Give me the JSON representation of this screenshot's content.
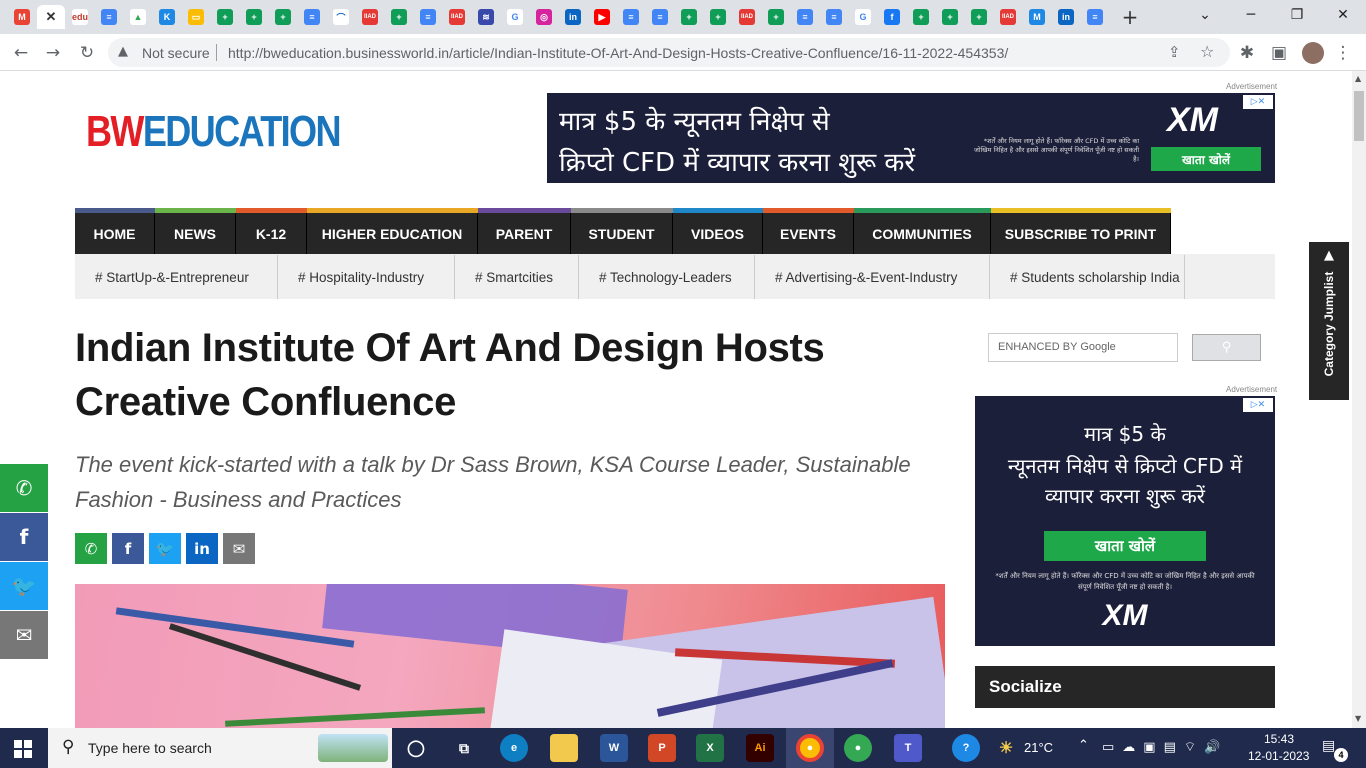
{
  "browser": {
    "tabs": [
      {
        "icon": "gmail-icon",
        "label": "M",
        "color": "#ea4335",
        "text": "#fff"
      },
      {
        "icon": "close-tab-icon",
        "label": "✕",
        "color": "#fff",
        "text": "#333",
        "active": true
      },
      {
        "icon": "edu-icon",
        "label": "edu",
        "color": "#fff",
        "text": "#c0392b"
      },
      {
        "icon": "docs-icon",
        "label": "≡",
        "color": "#4285f4",
        "text": "#fff"
      },
      {
        "icon": "drive-icon",
        "label": "▲",
        "color": "#fff",
        "text": "#34a853"
      },
      {
        "icon": "k-icon",
        "label": "K",
        "color": "#1e88e5",
        "text": "#fff"
      },
      {
        "icon": "slides-icon",
        "label": "▭",
        "color": "#fbbc04",
        "text": "#fff"
      },
      {
        "icon": "sheets-icon",
        "label": "+",
        "color": "#0f9d58",
        "text": "#fff"
      },
      {
        "icon": "sheets-icon",
        "label": "+",
        "color": "#0f9d58",
        "text": "#fff"
      },
      {
        "icon": "sheets-icon",
        "label": "+",
        "color": "#0f9d58",
        "text": "#fff"
      },
      {
        "icon": "docs-icon",
        "label": "≡",
        "color": "#4285f4",
        "text": "#fff"
      },
      {
        "icon": "arc-icon",
        "label": "⌒",
        "color": "#fff",
        "text": "#1565c0"
      },
      {
        "icon": "iiad-icon",
        "label": "IIAD",
        "color": "#e53935",
        "text": "#fff"
      },
      {
        "icon": "sheets-icon",
        "label": "+",
        "color": "#0f9d58",
        "text": "#fff"
      },
      {
        "icon": "docs-icon",
        "label": "≡",
        "color": "#4285f4",
        "text": "#fff"
      },
      {
        "icon": "iiad-icon",
        "label": "IIAD",
        "color": "#e53935",
        "text": "#fff"
      },
      {
        "icon": "stack-icon",
        "label": "≋",
        "color": "#3949ab",
        "text": "#fff"
      },
      {
        "icon": "google-icon",
        "label": "G",
        "color": "#fff",
        "text": "#4285f4"
      },
      {
        "icon": "instagram-icon",
        "label": "◎",
        "color": "#d6249f",
        "text": "#fff"
      },
      {
        "icon": "linkedin-icon",
        "label": "in",
        "color": "#0a66c2",
        "text": "#fff"
      },
      {
        "icon": "youtube-icon",
        "label": "▶",
        "color": "#ff0000",
        "text": "#fff"
      },
      {
        "icon": "docs-icon",
        "label": "≡",
        "color": "#4285f4",
        "text": "#fff"
      },
      {
        "icon": "docs-icon",
        "label": "≡",
        "color": "#4285f4",
        "text": "#fff"
      },
      {
        "icon": "sheets-icon",
        "label": "+",
        "color": "#0f9d58",
        "text": "#fff"
      },
      {
        "icon": "sheets-icon",
        "label": "+",
        "color": "#0f9d58",
        "text": "#fff"
      },
      {
        "icon": "iiad-icon",
        "label": "IIAD",
        "color": "#e53935",
        "text": "#fff"
      },
      {
        "icon": "sheets-icon",
        "label": "+",
        "color": "#0f9d58",
        "text": "#fff"
      },
      {
        "icon": "docs-icon",
        "label": "≡",
        "color": "#4285f4",
        "text": "#fff"
      },
      {
        "icon": "docs-icon",
        "label": "≡",
        "color": "#4285f4",
        "text": "#fff"
      },
      {
        "icon": "google-icon",
        "label": "G",
        "color": "#fff",
        "text": "#4285f4"
      },
      {
        "icon": "facebook-icon",
        "label": "f",
        "color": "#1877f2",
        "text": "#fff"
      },
      {
        "icon": "sheets-icon",
        "label": "+",
        "color": "#0f9d58",
        "text": "#fff"
      },
      {
        "icon": "sheets-icon",
        "label": "+",
        "color": "#0f9d58",
        "text": "#fff"
      },
      {
        "icon": "sheets-icon",
        "label": "+",
        "color": "#0f9d58",
        "text": "#fff"
      },
      {
        "icon": "iiad-icon",
        "label": "IIAD",
        "color": "#e53935",
        "text": "#fff"
      },
      {
        "icon": "mail-icon",
        "label": "M",
        "color": "#1e88e5",
        "text": "#fff"
      },
      {
        "icon": "linkedin-icon",
        "label": "in",
        "color": "#0a66c2",
        "text": "#fff"
      },
      {
        "icon": "docs-icon",
        "label": "≡",
        "color": "#4285f4",
        "text": "#fff"
      }
    ],
    "new_tab": "+",
    "security_label": "Not secure",
    "url": "http://bweducation.businessworld.in/article/Indian-Institute-Of-Art-And-Design-Hosts-Creative-Confluence/16-11-2022-454353/"
  },
  "site": {
    "logo_bw": "BW",
    "logo_edu": "EDUCATION",
    "ad_label": "Advertisement",
    "nav": [
      {
        "label": "HOME",
        "color": "#4a5a8a"
      },
      {
        "label": "NEWS",
        "color": "#6bb44a"
      },
      {
        "label": "K-12",
        "color": "#e05a2a"
      },
      {
        "label": "HIGHER EDUCATION",
        "color": "#e8a825"
      },
      {
        "label": "PARENT",
        "color": "#6a4a9a"
      },
      {
        "label": "STUDENT",
        "color": "#8a8a8a"
      },
      {
        "label": "VIDEOS",
        "color": "#1e88c8"
      },
      {
        "label": "EVENTS",
        "color": "#e05a2a"
      },
      {
        "label": "COMMUNITIES",
        "color": "#2a9a5a"
      },
      {
        "label": "SUBSCRIBE TO PRINT",
        "color": "#e8c025"
      }
    ],
    "tags": [
      "# StartUp-&-Entrepreneur",
      "# Hospitality-Industry",
      "# Smartcities",
      "# Technology-Leaders",
      "# Advertising-&-Event-Industry",
      "# Students scholarship India"
    ]
  },
  "article": {
    "title": "Indian Institute Of Art And Design Hosts Creative Confluence",
    "subtitle": "The event kick-started with a talk by Dr Sass Brown, KSA Course Leader, Sustainable Fashion - Business and Practices"
  },
  "sidebar": {
    "search_placeholder": "ENHANCED BY Google",
    "socialize": "Socialize",
    "jumplist": "Category Jumplist"
  },
  "ads": {
    "top_line1": "मात्र $5 के न्यूनतम निक्षेप से",
    "top_line2": "क्रिप्टो CFD में व्यापार करना शुरू करें",
    "top_small": "*शर्तें और नियम लागू होते हैं। फॉरेक्स और CFD में उच्च कोटि का जोखिम निहित है और इससे आपकी संपूर्ण निवेशित पूँजी नष्ट हो सकती है।",
    "button": "खाता खोलें",
    "brand": "XM",
    "side_line1": "मात्र $5 के",
    "side_line2": "न्यूनतम निक्षेप से क्रिप्टो CFD में",
    "side_line3": "व्यापार करना शुरू करें",
    "side_small": "*शर्तें और नियम लागू होते हैं। फॉरेक्स और CFD में उच्च कोटि का जोखिम निहित है और इससे आपकी संपूर्ण निवेशित पूँजी नष्ट हो सकती है।"
  },
  "taskbar": {
    "search_placeholder": "Type here to search",
    "temperature": "21°C",
    "time": "15:43",
    "date": "12-01-2023",
    "notifications": "4"
  }
}
